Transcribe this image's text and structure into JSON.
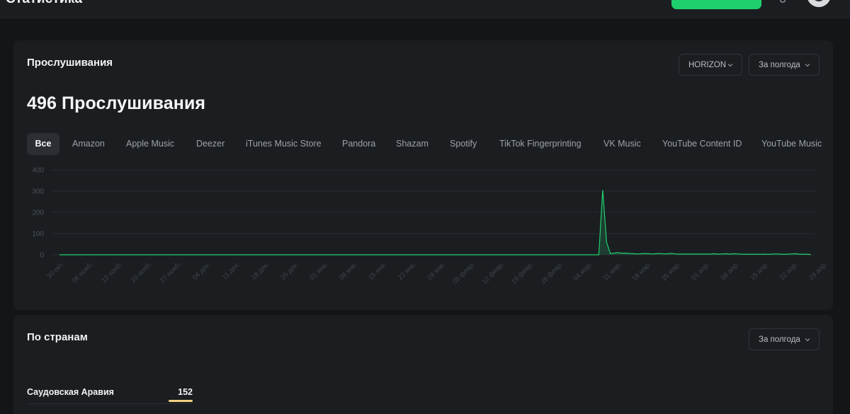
{
  "header": {
    "title": "Статистика",
    "accent": "#1fcf6e"
  },
  "listens": {
    "title": "Прослушивания",
    "source_select": "HORIZON",
    "period_select": "За полгода",
    "total_label": "496 Прослушивания",
    "tabs": [
      "Все",
      "Amazon",
      "Apple Music",
      "Deezer",
      "iTunes Music Store",
      "Pandora",
      "Shazam",
      "Spotify",
      "TikTok Fingerprinting",
      "VK Music",
      "YouTube Content ID",
      "YouTube Music"
    ],
    "active_tab": "Все"
  },
  "chart_data": {
    "type": "line",
    "ylim": [
      0,
      400
    ],
    "yticks": [
      0,
      100,
      200,
      300,
      400
    ],
    "xticks": [
      "30 окт.",
      "06 нояб.",
      "13 нояб.",
      "20 нояб.",
      "27 нояб.",
      "04 дек.",
      "11 дек.",
      "18 дек.",
      "25 дек.",
      "01 янв.",
      "08 янв.",
      "15 янв.",
      "22 янв.",
      "29 янв.",
      "05 февр.",
      "12 февр.",
      "19 февр.",
      "26 февр.",
      "04 мар.",
      "11 мар.",
      "18 мар.",
      "25 мар.",
      "01 апр.",
      "08 апр.",
      "15 апр.",
      "22 апр.",
      "29 апр."
    ],
    "series": [
      {
        "color": "#1fcf6e",
        "points": [
          [
            0,
            0
          ],
          [
            140,
            0
          ],
          [
            141,
            305
          ],
          [
            142,
            60
          ],
          [
            143,
            5
          ],
          [
            144,
            8
          ],
          [
            145,
            10
          ],
          [
            146,
            7
          ],
          [
            147,
            8
          ],
          [
            148,
            6
          ],
          [
            149,
            5
          ],
          [
            150,
            4
          ],
          [
            151,
            5
          ],
          [
            152,
            6
          ],
          [
            153,
            5
          ],
          [
            154,
            4
          ],
          [
            155,
            5
          ],
          [
            156,
            6
          ],
          [
            157,
            4
          ],
          [
            158,
            5
          ],
          [
            159,
            6
          ],
          [
            160,
            4
          ],
          [
            161,
            3
          ],
          [
            162,
            4
          ],
          [
            163,
            3
          ],
          [
            164,
            4
          ],
          [
            165,
            3
          ],
          [
            166,
            4
          ],
          [
            167,
            3
          ],
          [
            168,
            4
          ],
          [
            169,
            3
          ],
          [
            170,
            5
          ],
          [
            171,
            3
          ],
          [
            172,
            4
          ],
          [
            173,
            5
          ],
          [
            174,
            3
          ],
          [
            175,
            5
          ],
          [
            176,
            4
          ],
          [
            177,
            3
          ],
          [
            178,
            2
          ],
          [
            179,
            3
          ],
          [
            180,
            2
          ],
          [
            181,
            3
          ],
          [
            182,
            2
          ],
          [
            183,
            3
          ],
          [
            184,
            2
          ],
          [
            185,
            3
          ],
          [
            186,
            4
          ],
          [
            187,
            3
          ],
          [
            188,
            2
          ],
          [
            189,
            3
          ],
          [
            190,
            4
          ],
          [
            191,
            5
          ],
          [
            192,
            3
          ],
          [
            193,
            2
          ],
          [
            194,
            3
          ],
          [
            195,
            1
          ]
        ]
      }
    ],
    "x_range": [
      0,
      196
    ],
    "grid": true
  },
  "countries": {
    "title": "По странам",
    "period_select": "За полгода",
    "rows": [
      {
        "name": "Саудовская Аравия",
        "value": "152",
        "bar_color": "#f2d184"
      }
    ]
  }
}
